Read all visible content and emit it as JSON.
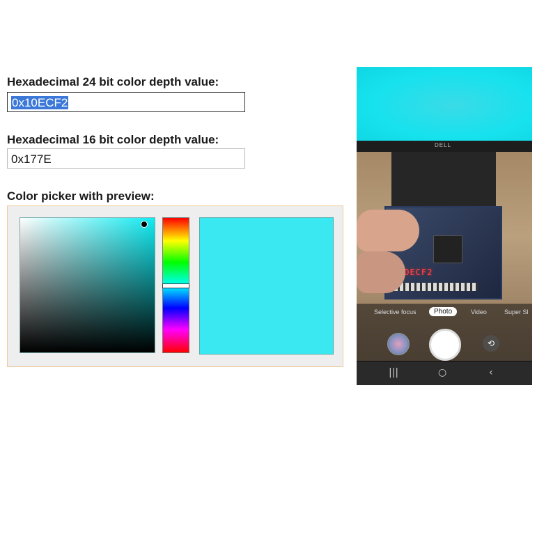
{
  "fields": {
    "hex24": {
      "label": "Hexadecimal 24 bit color depth value:",
      "value": "0x10ECF2"
    },
    "hex16": {
      "label": "Hexadecimal 16 bit color depth value:",
      "value": "0x177E"
    }
  },
  "picker": {
    "label": "Color picker with preview:",
    "preview_color": "#3AE8F2"
  },
  "phone": {
    "brand": "DELL",
    "seven_segment": "IDECF2",
    "modes": [
      "Selective focus",
      "Photo",
      "Video",
      "Super Sl"
    ],
    "nav": {
      "recents": "|||",
      "home": "○",
      "back": "‹"
    },
    "flip_icon": "⟲"
  }
}
